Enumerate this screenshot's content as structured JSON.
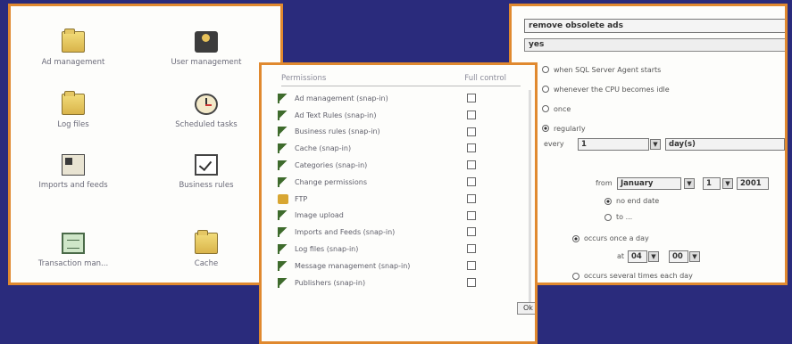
{
  "colors": {
    "background": "#2a2b7c",
    "panel_border": "#e0892f",
    "panel_bg": "#fdfdfb"
  },
  "admin_panel": {
    "tiles": [
      {
        "label": "Ad management",
        "icon": "folder-icon"
      },
      {
        "label": "User management",
        "icon": "user-icon"
      },
      {
        "label": "Log files",
        "icon": "folder-icon"
      },
      {
        "label": "Scheduled tasks",
        "icon": "clock-icon"
      },
      {
        "label": "Imports and feeds",
        "icon": "feed-icon"
      },
      {
        "label": "Business rules",
        "icon": "checklist-icon"
      },
      {
        "label": "Transaction man...",
        "icon": "screen-icon"
      },
      {
        "label": "Cache",
        "icon": "folder-icon"
      }
    ]
  },
  "permissions_panel": {
    "headers": {
      "permissions": "Permissions",
      "full_control": "Full control"
    },
    "rows": [
      {
        "label": "Ad management (snap-in)",
        "icon": "key-icon",
        "checked": false
      },
      {
        "label": "Ad Text Rules (snap-in)",
        "icon": "key-icon",
        "checked": false
      },
      {
        "label": "Business rules (snap-in)",
        "icon": "key-icon",
        "checked": false
      },
      {
        "label": "Cache (snap-in)",
        "icon": "key-icon",
        "checked": false
      },
      {
        "label": "Categories (snap-in)",
        "icon": "key-icon",
        "checked": false
      },
      {
        "label": "Change permissions",
        "icon": "key-icon",
        "checked": false
      },
      {
        "label": "FTP",
        "icon": "lock-icon",
        "checked": false
      },
      {
        "label": "Image upload",
        "icon": "key-icon",
        "checked": false
      },
      {
        "label": "Imports and Feeds (snap-in)",
        "icon": "key-icon",
        "checked": false
      },
      {
        "label": "Log files (snap-in)",
        "icon": "key-icon",
        "checked": false
      },
      {
        "label": "Message management (snap-in)",
        "icon": "key-icon",
        "checked": false
      },
      {
        "label": "Publishers (snap-in)",
        "icon": "key-icon",
        "checked": false
      }
    ],
    "ok_label": "Ok"
  },
  "schedule_panel": {
    "task_name": "remove obsolete ads",
    "enabled_value": "yes",
    "options": [
      {
        "label": "when SQL Server Agent starts",
        "icon": "agent-icon",
        "selected": false
      },
      {
        "label": "whenever the CPU becomes idle",
        "icon": "cpu-icon",
        "selected": false
      },
      {
        "label": "once",
        "icon": "calendar-icon",
        "selected": false
      },
      {
        "label": "regularly",
        "icon": "recurring-icon",
        "selected": true
      }
    ],
    "every_label": "every",
    "every_value": "1",
    "every_unit": "day(s)",
    "from_label": "from",
    "from_month": "January",
    "from_day": "1",
    "from_year": "2001",
    "no_end_date": "no end date",
    "to_label": "to ...",
    "occurs_once": "occurs once a day",
    "at_label": "at",
    "at_hour": "04",
    "at_minute": "00",
    "occurs_several": "occurs several times each day"
  }
}
